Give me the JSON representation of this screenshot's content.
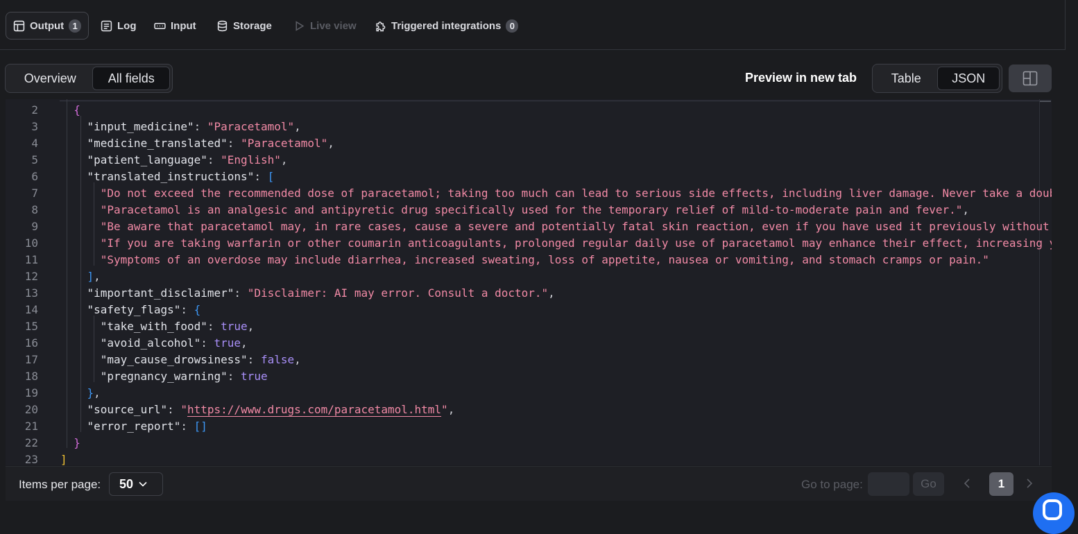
{
  "tabs": [
    {
      "label": "Output",
      "badge": "1",
      "icon": "table-icon"
    },
    {
      "label": "Log",
      "icon": "log-icon"
    },
    {
      "label": "Input",
      "icon": "input-icon"
    },
    {
      "label": "Storage",
      "icon": "database-icon"
    },
    {
      "label": "Live view",
      "icon": "play-icon"
    },
    {
      "label": "Triggered integrations",
      "badge": "0",
      "icon": "puzzle-icon"
    }
  ],
  "view_mode": {
    "overview": "Overview",
    "all_fields": "All fields",
    "selected": "All fields"
  },
  "preview_link": "Preview in new tab",
  "format_toggle": {
    "table": "Table",
    "json": "JSON",
    "selected": "JSON"
  },
  "json_lines": [
    {
      "n": "2",
      "indent": 1,
      "t": [
        [
          "br2",
          "{"
        ]
      ]
    },
    {
      "n": "3",
      "indent": 2,
      "t": [
        [
          "k",
          "\"input_medicine\""
        ],
        [
          "p",
          ": "
        ],
        [
          "s",
          "\"Paracetamol\""
        ],
        [
          "p",
          ","
        ]
      ]
    },
    {
      "n": "4",
      "indent": 2,
      "t": [
        [
          "k",
          "\"medicine_translated\""
        ],
        [
          "p",
          ": "
        ],
        [
          "s",
          "\"Paracetamol\""
        ],
        [
          "p",
          ","
        ]
      ]
    },
    {
      "n": "5",
      "indent": 2,
      "t": [
        [
          "k",
          "\"patient_language\""
        ],
        [
          "p",
          ": "
        ],
        [
          "s",
          "\"English\""
        ],
        [
          "p",
          ","
        ]
      ]
    },
    {
      "n": "6",
      "indent": 2,
      "t": [
        [
          "k",
          "\"translated_instructions\""
        ],
        [
          "p",
          ": "
        ],
        [
          "br3",
          "["
        ]
      ]
    },
    {
      "n": "7",
      "indent": 3,
      "t": [
        [
          "s",
          "\"Do not exceed the recommended dose of paracetamol; taking too much can lead to serious side effects, including liver damage. Never take a double dose"
        ]
      ]
    },
    {
      "n": "8",
      "indent": 3,
      "t": [
        [
          "s",
          "\"Paracetamol is an analgesic and antipyretic drug specifically used for the temporary relief of mild-to-moderate pain and fever.\""
        ],
        [
          "p",
          ","
        ]
      ]
    },
    {
      "n": "9",
      "indent": 3,
      "t": [
        [
          "s",
          "\"Be aware that paracetamol may, in rare cases, cause a severe and potentially fatal skin reaction, even if you have used it previously without problems"
        ]
      ]
    },
    {
      "n": "10",
      "indent": 3,
      "t": [
        [
          "s",
          "\"If you are taking warfarin or other coumarin anticoagulants, prolonged regular daily use of paracetamol may enhance their effect, increasing your risk"
        ]
      ]
    },
    {
      "n": "11",
      "indent": 3,
      "t": [
        [
          "s",
          "\"Symptoms of an overdose may include diarrhea, increased sweating, loss of appetite, nausea or vomiting, and stomach cramps or pain.\""
        ]
      ]
    },
    {
      "n": "12",
      "indent": 2,
      "t": [
        [
          "br3",
          "]"
        ],
        [
          "p",
          ","
        ]
      ]
    },
    {
      "n": "13",
      "indent": 2,
      "t": [
        [
          "k",
          "\"important_disclaimer\""
        ],
        [
          "p",
          ": "
        ],
        [
          "s",
          "\"Disclaimer: AI may error. Consult a doctor.\""
        ],
        [
          "p",
          ","
        ]
      ]
    },
    {
      "n": "14",
      "indent": 2,
      "t": [
        [
          "k",
          "\"safety_flags\""
        ],
        [
          "p",
          ": "
        ],
        [
          "br3",
          "{"
        ]
      ]
    },
    {
      "n": "15",
      "indent": 3,
      "t": [
        [
          "k",
          "\"take_with_food\""
        ],
        [
          "p",
          ": "
        ],
        [
          "b",
          "true"
        ],
        [
          "p",
          ","
        ]
      ]
    },
    {
      "n": "16",
      "indent": 3,
      "t": [
        [
          "k",
          "\"avoid_alcohol\""
        ],
        [
          "p",
          ": "
        ],
        [
          "b",
          "true"
        ],
        [
          "p",
          ","
        ]
      ]
    },
    {
      "n": "17",
      "indent": 3,
      "t": [
        [
          "k",
          "\"may_cause_drowsiness\""
        ],
        [
          "p",
          ": "
        ],
        [
          "b",
          "false"
        ],
        [
          "p",
          ","
        ]
      ]
    },
    {
      "n": "18",
      "indent": 3,
      "t": [
        [
          "k",
          "\"pregnancy_warning\""
        ],
        [
          "p",
          ": "
        ],
        [
          "b",
          "true"
        ]
      ]
    },
    {
      "n": "19",
      "indent": 2,
      "t": [
        [
          "br3",
          "}"
        ],
        [
          "p",
          ","
        ]
      ]
    },
    {
      "n": "20",
      "indent": 2,
      "t": [
        [
          "k",
          "\"source_url\""
        ],
        [
          "p",
          ": "
        ],
        [
          "s",
          "\""
        ],
        [
          "u",
          "https://www.drugs.com/paracetamol.html"
        ],
        [
          "s",
          "\""
        ],
        [
          "p",
          ","
        ]
      ]
    },
    {
      "n": "21",
      "indent": 2,
      "t": [
        [
          "k",
          "\"error_report\""
        ],
        [
          "p",
          ": "
        ],
        [
          "br3",
          "[]"
        ]
      ]
    },
    {
      "n": "22",
      "indent": 1,
      "t": [
        [
          "br2",
          "}"
        ]
      ]
    },
    {
      "n": "23",
      "indent": 0,
      "t": [
        [
          "br1",
          "]"
        ]
      ]
    }
  ],
  "footer": {
    "items_per_page_label": "Items per page:",
    "items_per_page_value": "50",
    "go_to_page_label": "Go to page:",
    "go_button": "Go",
    "current_page": "1"
  }
}
